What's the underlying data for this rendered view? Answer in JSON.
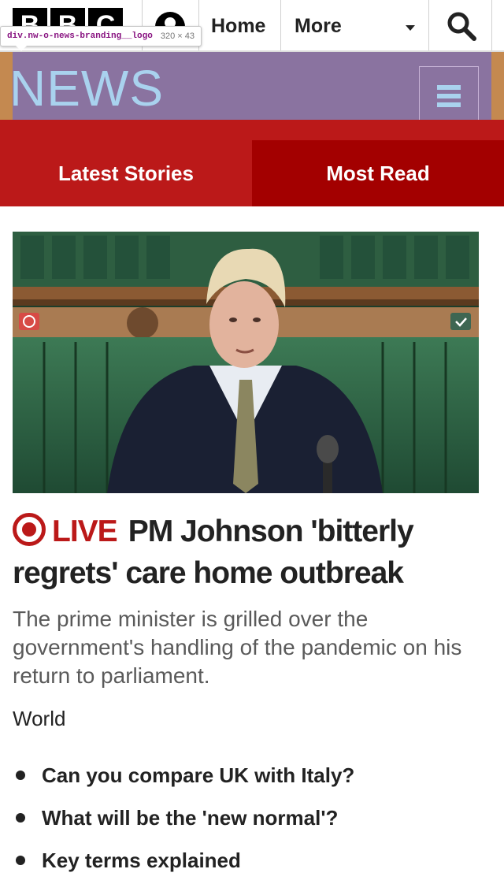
{
  "devtools_tooltip": {
    "selector": "div.nw-o-news-branding__logo",
    "dimensions": "320 × 43"
  },
  "bbc_nav": {
    "logo_letters": [
      "B",
      "B",
      "C"
    ],
    "links": [
      {
        "label": "Home"
      },
      {
        "label": "More"
      }
    ],
    "icons": [
      "account-icon",
      "search-icon",
      "chevron-down-icon"
    ]
  },
  "branding": {
    "title": "NEWS",
    "menu_icon": "hamburger-icon"
  },
  "tabs": [
    {
      "label": "Latest Stories",
      "selected": false
    },
    {
      "label": "Most Read",
      "selected": true
    }
  ],
  "lead_story": {
    "image_alt": "Boris Johnson seated in the House of Commons",
    "live_label": "LIVE",
    "headline": "PM Johnson 'bitterly regrets' care home outbreak",
    "summary": "The prime minister is grilled over the government's handling of the pandemic on his return to parliament.",
    "section": "World",
    "related": [
      "Can you compare UK with Italy?",
      "What will be the 'new normal'?",
      "Key terms explained"
    ]
  },
  "colors": {
    "bbc_red": "#bb1919",
    "tab_selected": "#a30000",
    "devtools_highlight": "#8a73a0",
    "news_text": "#a9d2ee"
  }
}
